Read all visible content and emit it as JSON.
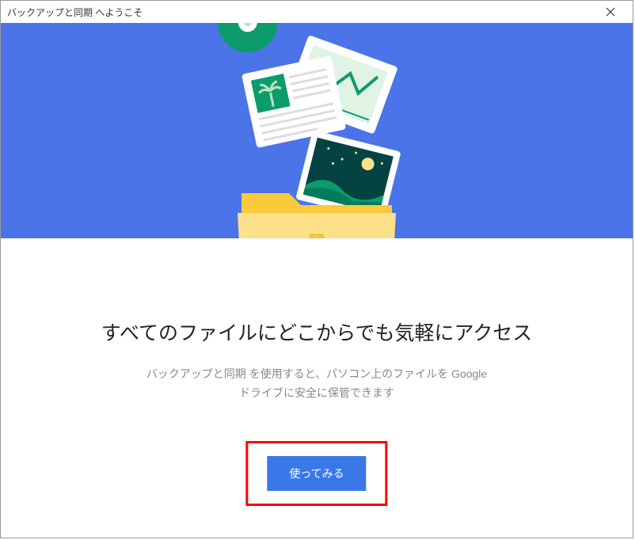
{
  "window": {
    "title": "バックアップと同期 へようこそ"
  },
  "main": {
    "heading": "すべてのファイルにどこからでも気軽にアクセス",
    "subtext_line1": "バックアップと同期 を使用すると、パソコン上のファイルを Google",
    "subtext_line2": "ドライブに安全に保管できます"
  },
  "cta": {
    "label": "使ってみる"
  }
}
